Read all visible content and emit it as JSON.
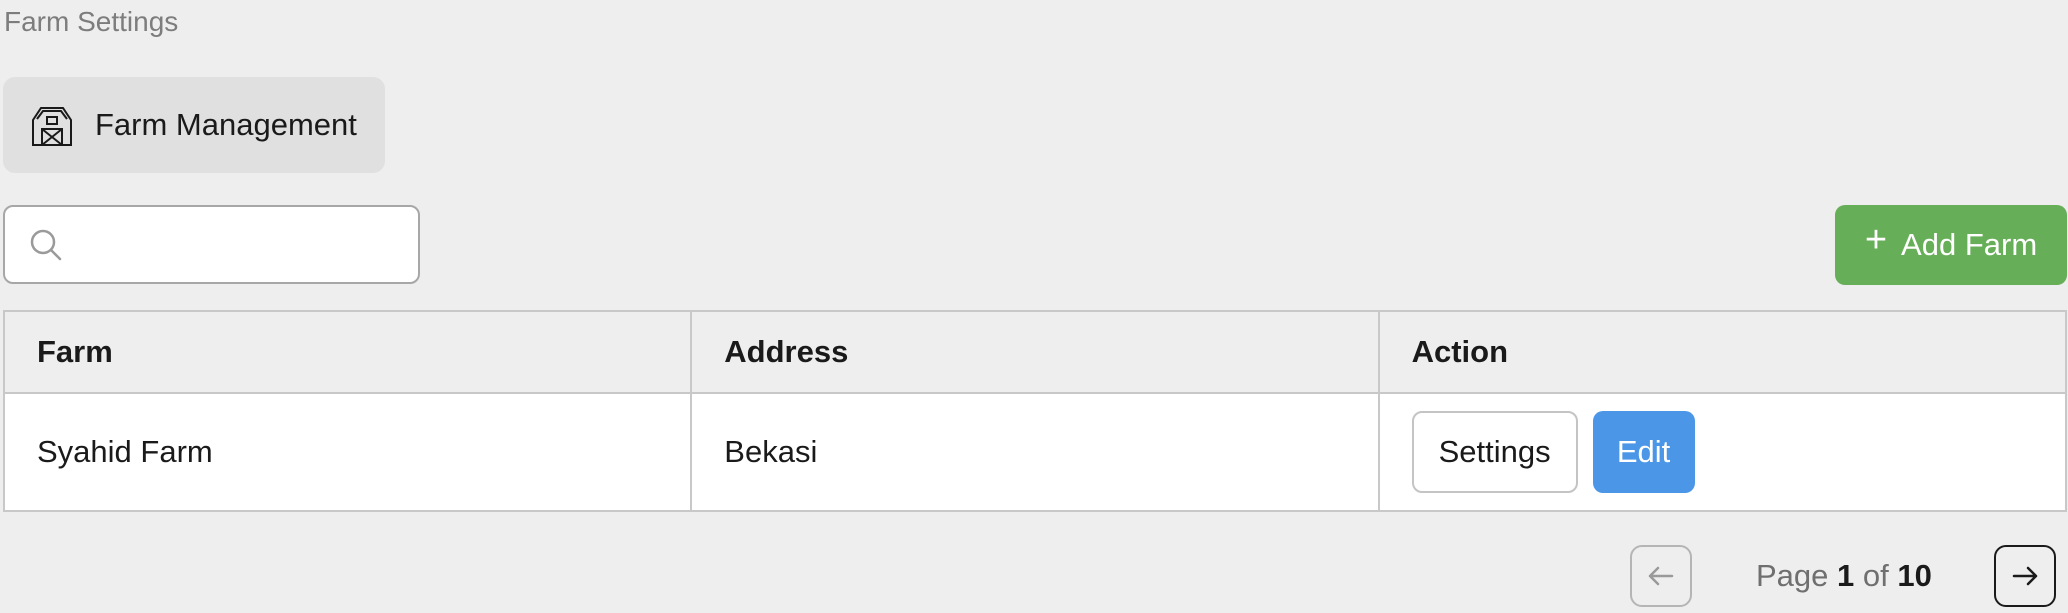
{
  "page": {
    "title": "Farm Settings"
  },
  "tab": {
    "label": "Farm Management",
    "icon": "barn-icon"
  },
  "search": {
    "placeholder": "",
    "value": "",
    "icon": "search-icon"
  },
  "add_button": {
    "label": "Add Farm",
    "icon": "plus-icon",
    "color": "#67ae58"
  },
  "table": {
    "headers": {
      "farm": "Farm",
      "address": "Address",
      "action": "Action"
    },
    "rows": [
      {
        "farm": "Syahid Farm",
        "address": "Bekasi",
        "settings_label": "Settings",
        "edit_label": "Edit"
      }
    ]
  },
  "pagination": {
    "prefix": "Page",
    "current": "1",
    "separator": "of",
    "total": "10",
    "prev_icon": "arrow-left-icon",
    "next_icon": "arrow-right-icon"
  },
  "colors": {
    "edit": "#4c96e8",
    "background": "#eeeeee"
  }
}
